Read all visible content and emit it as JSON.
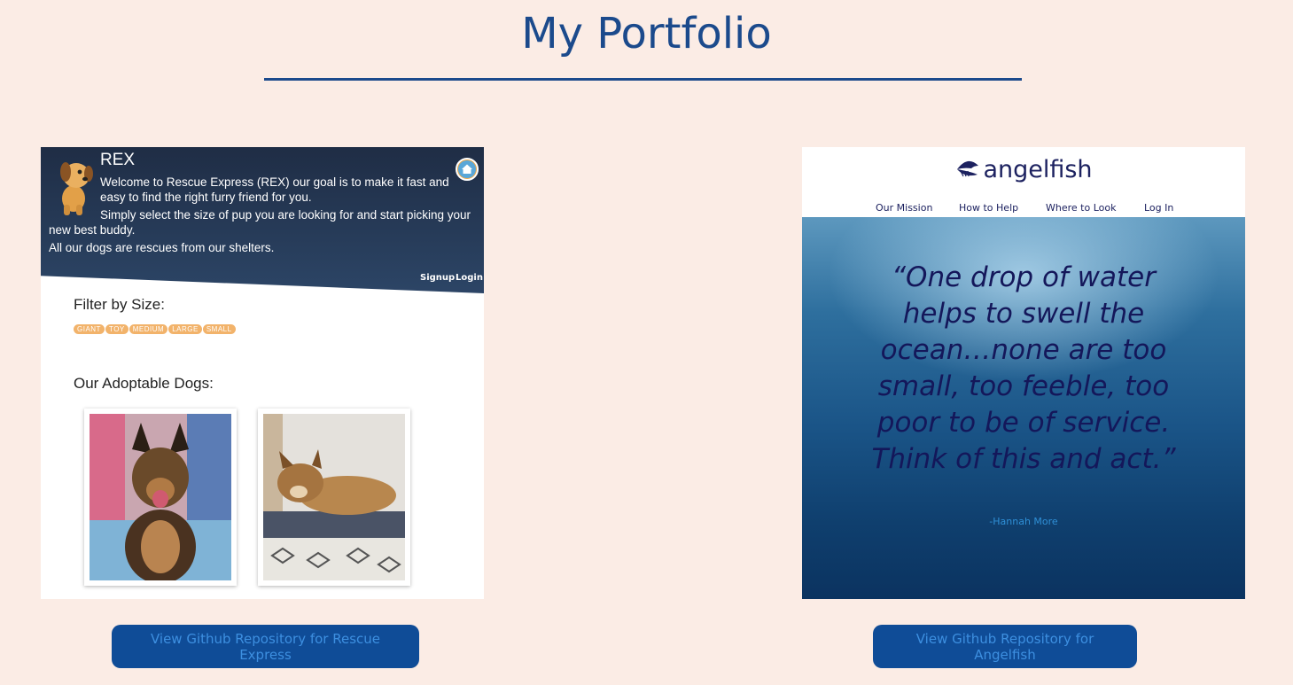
{
  "page": {
    "title": "My Portfolio"
  },
  "projects": [
    {
      "name": "REX",
      "intro_lines": [
        "Welcome to Rescue Express (REX) our goal is to make it fast and",
        "easy to find the right furry friend for you.",
        "Simply select the size of pup you are looking for and start picking your",
        "new best buddy.",
        "All our dogs are rescues from our shelters."
      ],
      "auth": [
        "Signup",
        "Login"
      ],
      "filter_label": "Filter by Size:",
      "sizes": [
        "GIANT",
        "TOY",
        "MEDIUM",
        "LARGE",
        "SMALL"
      ],
      "dogs_label": "Our Adoptable Dogs:",
      "button": "View Github Repository for Rescue Express"
    },
    {
      "name": "angelfish",
      "nav": [
        "Our Mission",
        "How to Help",
        "Where to Look",
        "Log In"
      ],
      "quote": "“One drop of water helps to swell the ocean…none are too small, too feeble, too poor to be of service. Think of this and act.”",
      "attribution": "-Hannah More",
      "button": "View Github Repository for Angelfish"
    }
  ],
  "colors": {
    "background": "#fbece5",
    "accent": "#1b4a8c",
    "button": "#0f4c97"
  },
  "icons": [
    "dog-mascot-icon",
    "home-icon",
    "angelfish-logo-icon"
  ]
}
